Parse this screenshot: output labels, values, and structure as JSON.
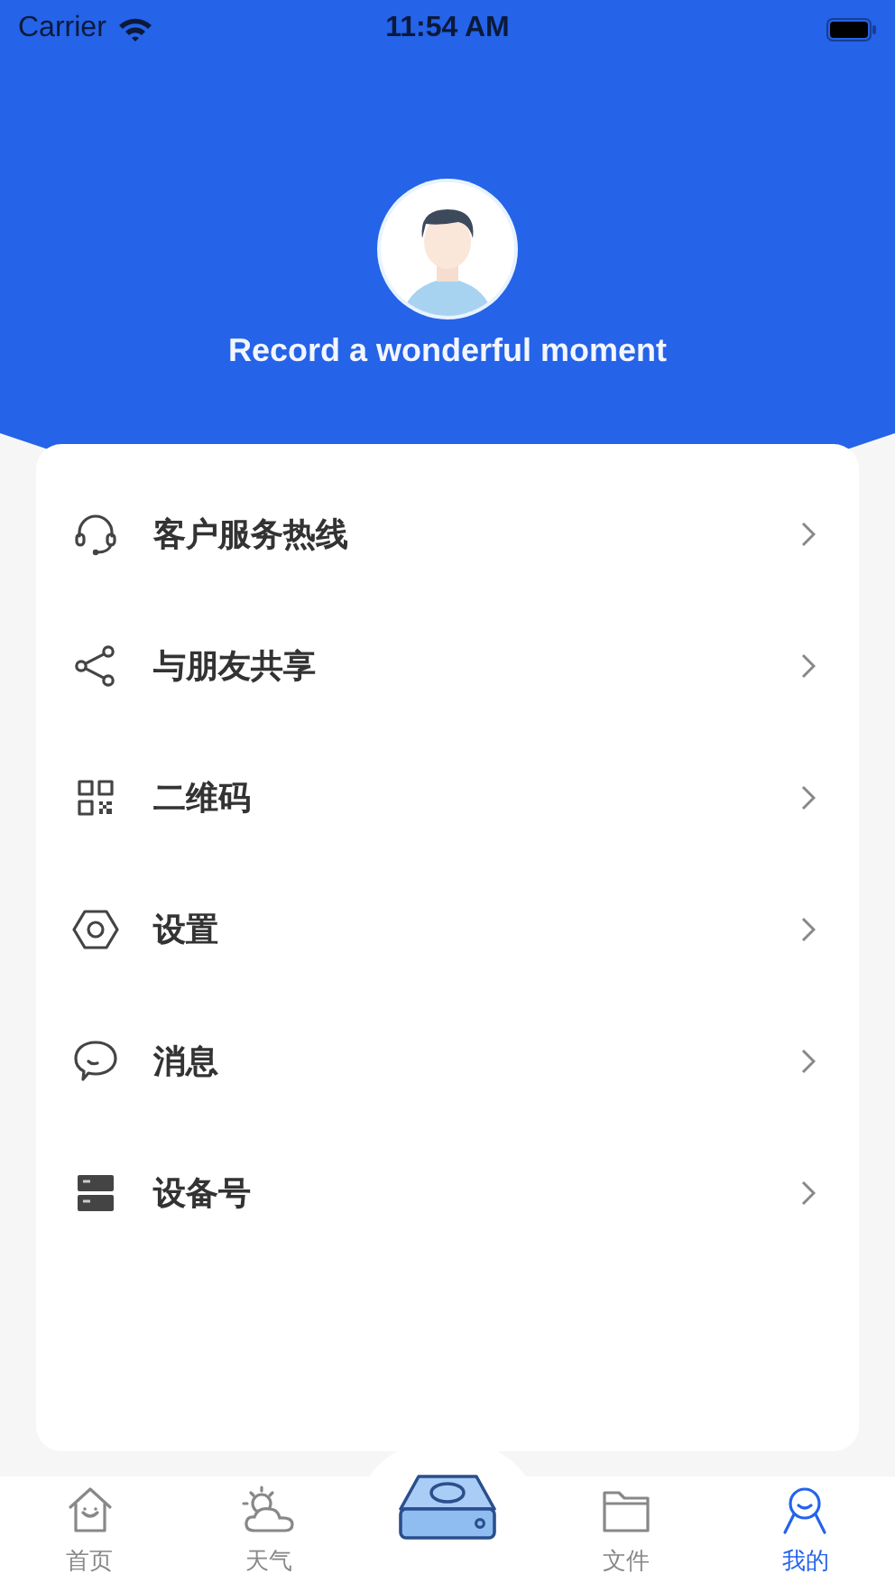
{
  "status_bar": {
    "carrier": "Carrier",
    "time": "11:54 AM"
  },
  "header": {
    "tagline": "Record a wonderful moment"
  },
  "menu": [
    {
      "kind": "headset",
      "label": "客户服务热线"
    },
    {
      "kind": "share",
      "label": "与朋友共享"
    },
    {
      "kind": "qrcode",
      "label": "二维码"
    },
    {
      "kind": "settings",
      "label": "设置"
    },
    {
      "kind": "message",
      "label": "消息"
    },
    {
      "kind": "device",
      "label": "设备号"
    }
  ],
  "tab_bar": [
    {
      "kind": "home",
      "label": "首页",
      "selected": false
    },
    {
      "kind": "weather",
      "label": "天气",
      "selected": false
    },
    {
      "kind": "drive",
      "selected": false
    },
    {
      "kind": "folder",
      "label": "文件",
      "selected": false
    },
    {
      "kind": "person",
      "label": "我的",
      "selected": true
    }
  ]
}
